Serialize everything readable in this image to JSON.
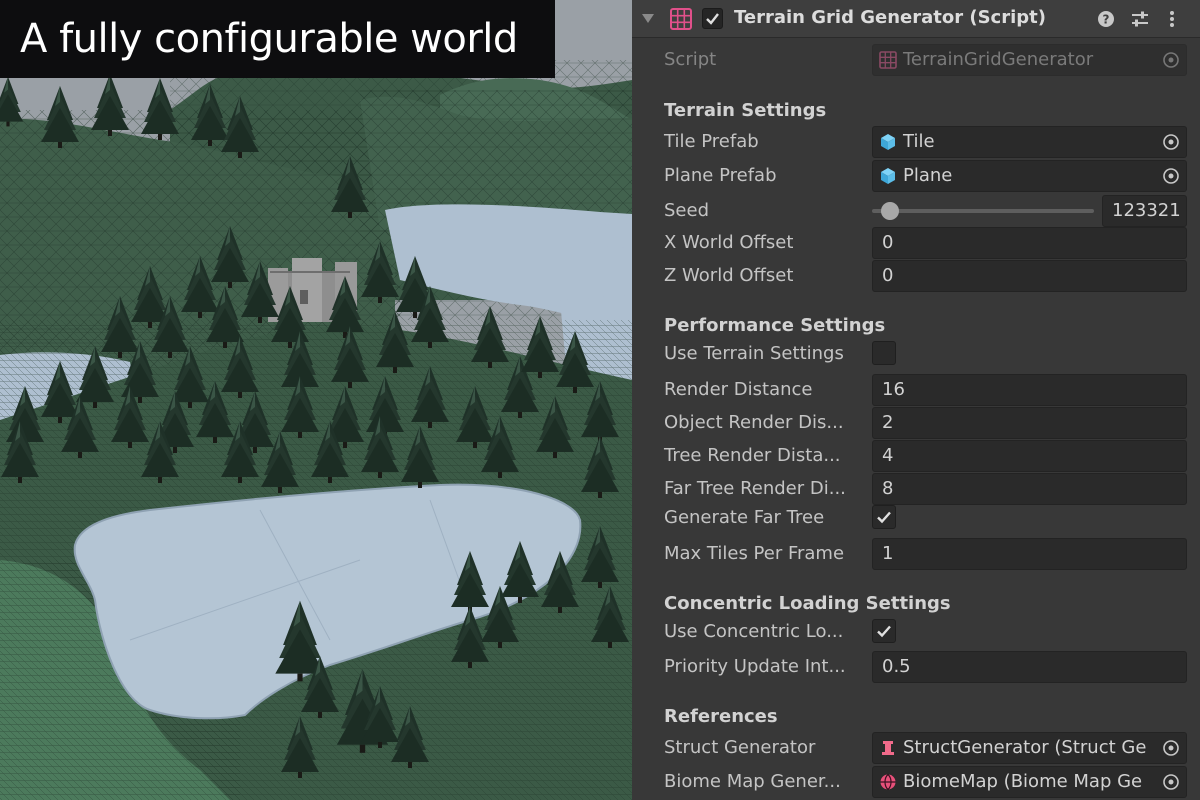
{
  "caption": "A fully configurable world",
  "component": {
    "title": "Terrain Grid Generator (Script)",
    "enabled": true,
    "script_label": "Script",
    "script_value": "TerrainGridGenerator"
  },
  "terrain_settings": {
    "heading": "Terrain Settings",
    "tile_prefab": {
      "label": "Tile Prefab",
      "value": "Tile",
      "icon": "prefab-cube-icon"
    },
    "plane_prefab": {
      "label": "Plane Prefab",
      "value": "Plane",
      "icon": "prefab-cube-icon"
    },
    "seed": {
      "label": "Seed",
      "value": "123321",
      "slider_fraction": 0.08
    },
    "x_world_offset": {
      "label": "X World Offset",
      "value": "0"
    },
    "z_world_offset": {
      "label": "Z World Offset",
      "value": "0"
    }
  },
  "performance_settings": {
    "heading": "Performance Settings",
    "use_terrain_settings": {
      "label": "Use Terrain Settings",
      "checked": false
    },
    "render_distance": {
      "label": "Render Distance",
      "value": "16"
    },
    "object_render_distance": {
      "label": "Object Render Dis...",
      "value": "2"
    },
    "tree_render_distance": {
      "label": "Tree Render Dista...",
      "value": "4"
    },
    "far_tree_render_distance": {
      "label": "Far Tree Render Di...",
      "value": "8"
    },
    "generate_far_tree": {
      "label": "Generate Far Tree",
      "checked": true
    },
    "max_tiles_per_frame": {
      "label": "Max Tiles Per Frame",
      "value": "1"
    }
  },
  "concentric_loading_settings": {
    "heading": "Concentric Loading Settings",
    "use_concentric_loading": {
      "label": "Use Concentric Lo...",
      "checked": true
    },
    "priority_update_interval": {
      "label": "Priority Update Int...",
      "value": "0.5"
    }
  },
  "references": {
    "heading": "References",
    "struct_generator": {
      "label": "Struct Generator",
      "value": "StructGenerator (Struct Ge",
      "icon": "struct-generator-icon"
    },
    "biome_map_generator": {
      "label": "Biome Map Gener...",
      "value": "BiomeMap (Biome Map Ge",
      "icon": "globe-icon"
    }
  },
  "colors": {
    "inspector_bg": "#383838",
    "field_bg": "#2a2a2a",
    "label_text": "#c4c4c4",
    "water": "#aebfd0",
    "terrain": "#3d5a48"
  }
}
